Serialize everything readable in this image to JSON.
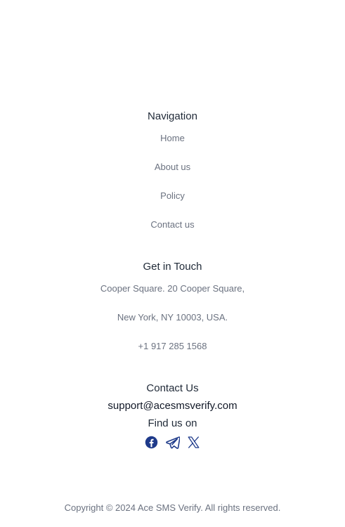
{
  "navigation": {
    "heading": "Navigation",
    "items": [
      {
        "label": "Home"
      },
      {
        "label": "About us"
      },
      {
        "label": "Policy"
      },
      {
        "label": "Contact us"
      }
    ]
  },
  "get_in_touch": {
    "heading": "Get in Touch",
    "address_line1": "Cooper Square. 20 Cooper Square,",
    "address_line2": "New York, NY 10003, USA.",
    "phone": "+1 917 285 1568"
  },
  "contact": {
    "heading": "Contact Us",
    "email": "support@acesmsverify.com"
  },
  "social": {
    "heading": "Find us on",
    "icons": [
      "facebook-icon",
      "telegram-icon",
      "x-icon"
    ],
    "color": "#1e3a8a"
  },
  "footer": {
    "copyright": "Copyright © 2024 Ace SMS Verify. All rights reserved."
  }
}
